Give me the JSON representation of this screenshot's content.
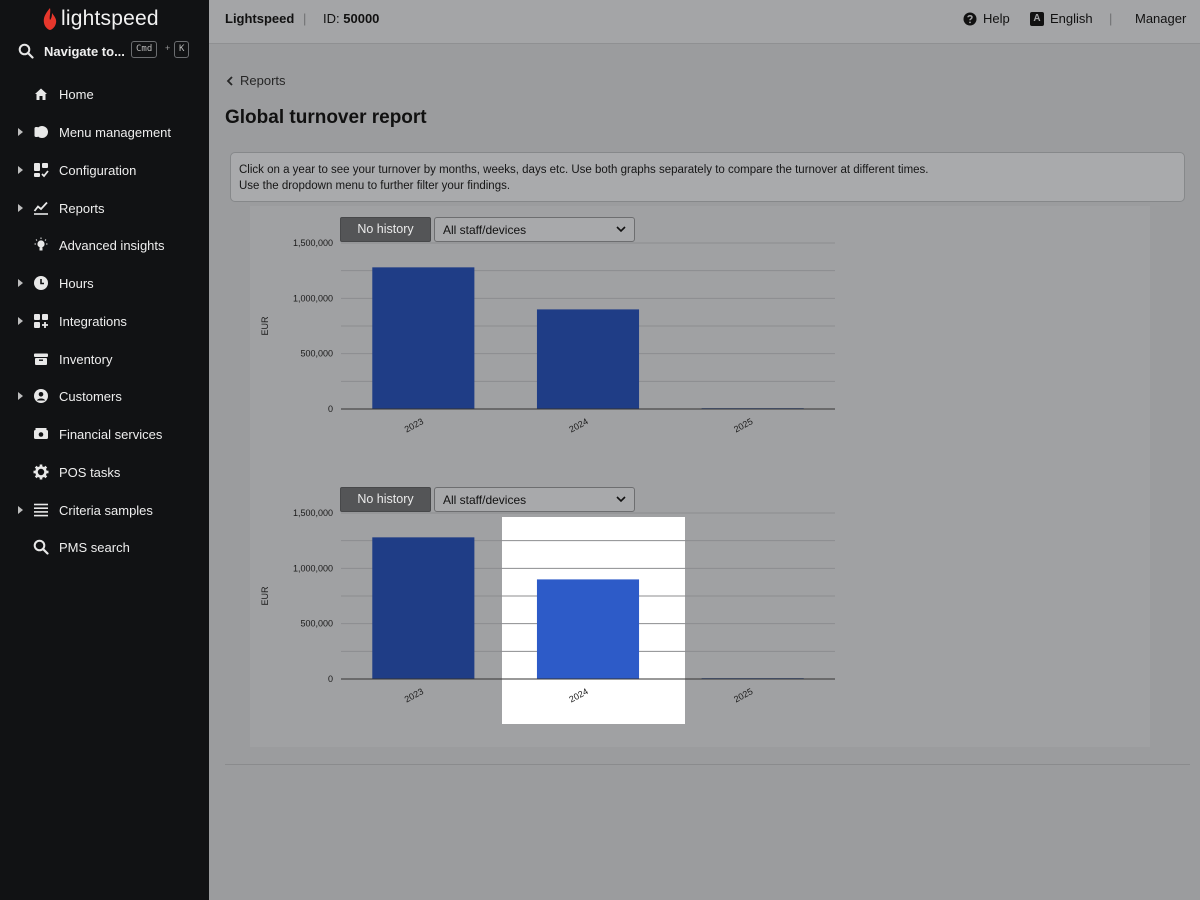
{
  "brand": {
    "logo_text": "lightspeed"
  },
  "navigate": {
    "label": "Navigate to...",
    "kbd_cmd": "Cmd",
    "kbd_plus": "+",
    "kbd_k": "K"
  },
  "sidebar": {
    "items": [
      {
        "label": "Home",
        "icon": "home-icon",
        "expandable": false
      },
      {
        "label": "Menu management",
        "icon": "menu-management-icon",
        "expandable": true
      },
      {
        "label": "Configuration",
        "icon": "configuration-icon",
        "expandable": true
      },
      {
        "label": "Reports",
        "icon": "reports-icon",
        "expandable": true
      },
      {
        "label": "Advanced insights",
        "icon": "lightbulb-icon",
        "expandable": false
      },
      {
        "label": "Hours",
        "icon": "clock-icon",
        "expandable": true
      },
      {
        "label": "Integrations",
        "icon": "integrations-icon",
        "expandable": true
      },
      {
        "label": "Inventory",
        "icon": "inventory-icon",
        "expandable": false
      },
      {
        "label": "Customers",
        "icon": "customer-icon",
        "expandable": true
      },
      {
        "label": "Financial services",
        "icon": "financial-services-icon",
        "expandable": false
      },
      {
        "label": "POS tasks",
        "icon": "gear-icon",
        "expandable": false
      },
      {
        "label": "Criteria samples",
        "icon": "list-icon",
        "expandable": true
      },
      {
        "label": "PMS search",
        "icon": "search-icon",
        "expandable": false
      }
    ]
  },
  "topbar": {
    "brand": "Lightspeed",
    "separator": "|",
    "id_label": "ID:",
    "id_value": "50000",
    "help": "Help",
    "language": "English",
    "language_badge": "A",
    "user": "Manager"
  },
  "breadcrumb": {
    "label": "Reports"
  },
  "page": {
    "title": "Global turnover report"
  },
  "info": {
    "line1": "Click on a year to see your turnover by months, weeks, days etc. Use both graphs separately to compare the turnover at different times.",
    "line2": "Use the dropdown menu to further filter your findings."
  },
  "controls": [
    {
      "history_label": "No history",
      "select_value": "All staff/devices"
    },
    {
      "history_label": "No history",
      "select_value": "All staff/devices"
    }
  ],
  "colors": {
    "bar": "#1f3d86",
    "bar_highlight": "#2d5bc8",
    "accent": "#e6372c"
  },
  "chart_data": [
    {
      "type": "bar",
      "categories": [
        "2023",
        "2024",
        "2025"
      ],
      "values": [
        1280000,
        900000,
        0
      ],
      "ylabel": "EUR",
      "ylim": [
        0,
        1500000
      ],
      "yticks": [
        "0",
        "500,000",
        "1,000,000",
        "1,500,000"
      ],
      "grid": true
    },
    {
      "type": "bar",
      "categories": [
        "2023",
        "2024",
        "2025"
      ],
      "values": [
        1280000,
        900000,
        0
      ],
      "ylabel": "EUR",
      "ylim": [
        0,
        1500000
      ],
      "yticks": [
        "0",
        "500,000",
        "1,000,000",
        "1,500,000"
      ],
      "grid": true,
      "highlighted_category": "2024"
    }
  ]
}
